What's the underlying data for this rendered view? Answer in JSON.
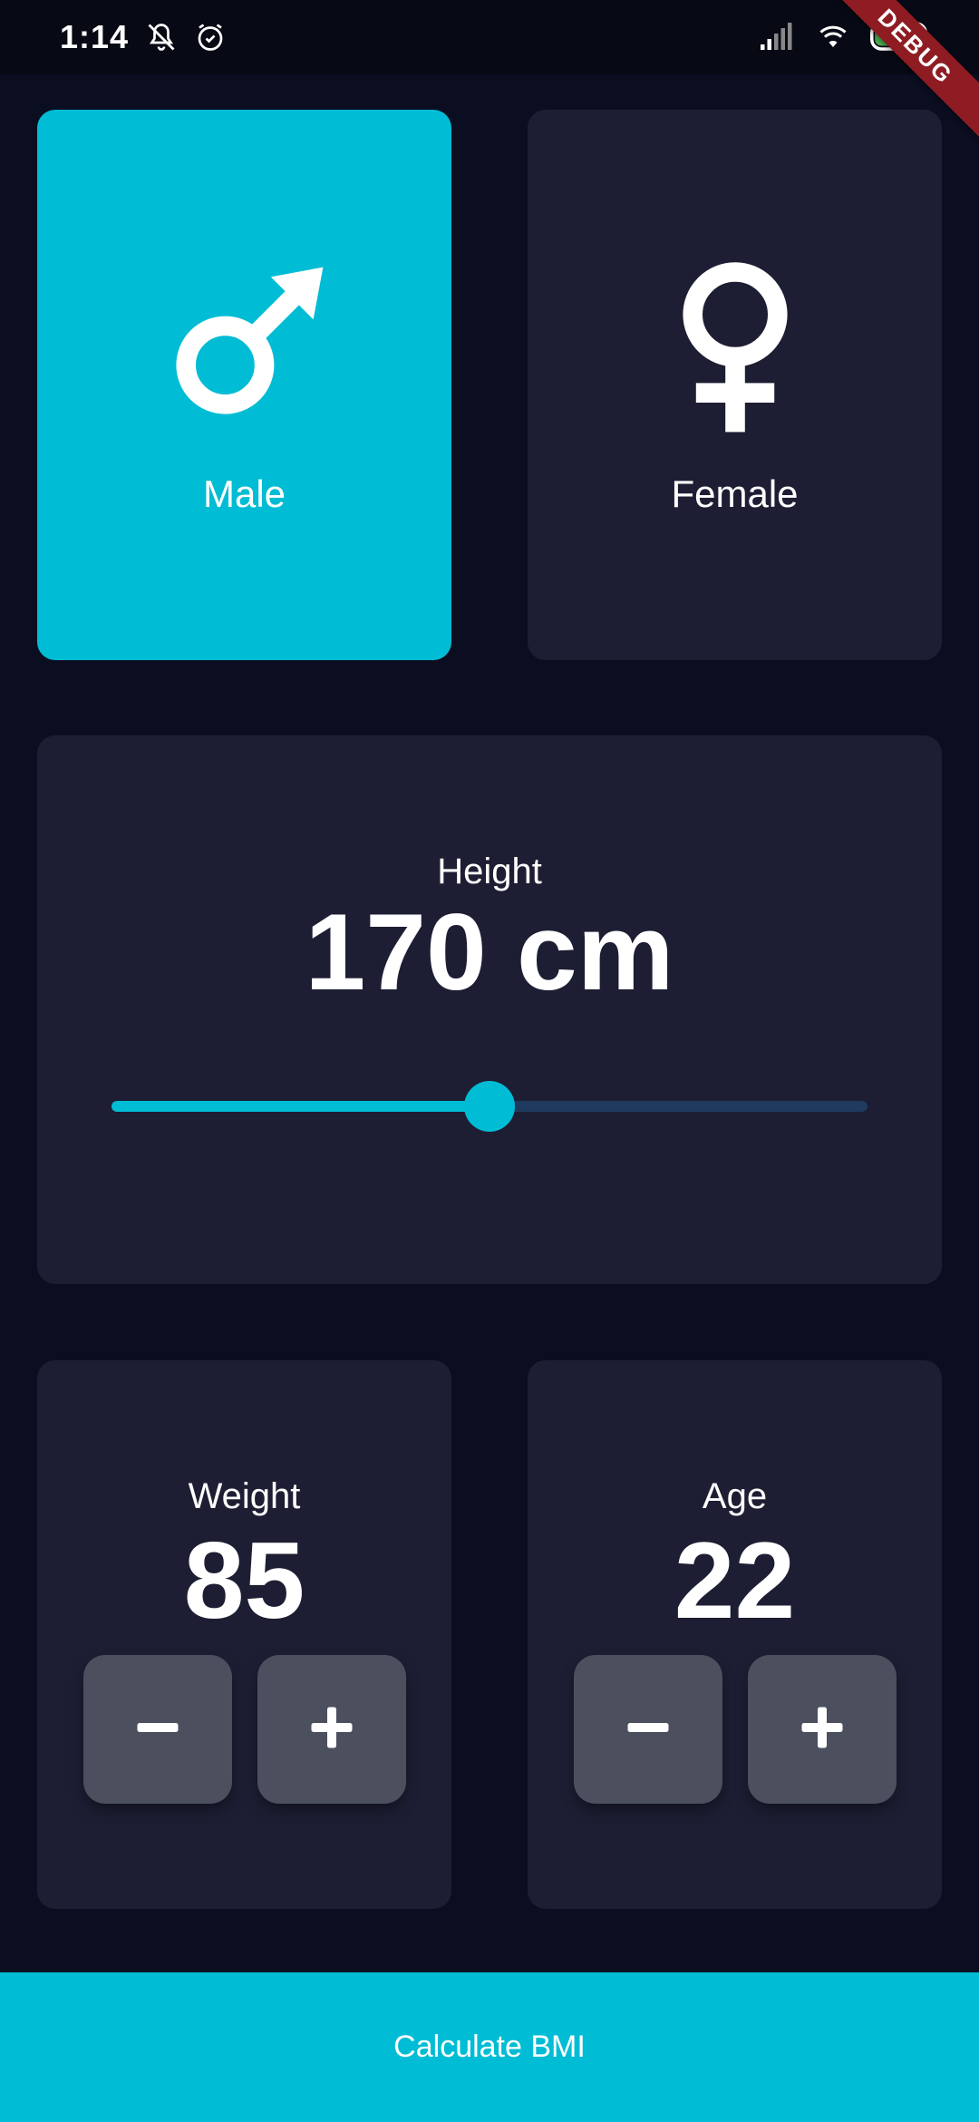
{
  "status_bar": {
    "time": "1:14",
    "icons": [
      "notifications-off-icon",
      "alarm-icon",
      "signal-icon",
      "wifi-icon",
      "battery-charging-icon"
    ],
    "debug_banner": "DEBUG"
  },
  "gender": {
    "male": {
      "label": "Male",
      "icon": "male-symbol-icon",
      "selected": true
    },
    "female": {
      "label": "Female",
      "icon": "female-symbol-icon",
      "selected": false
    }
  },
  "height": {
    "label": "Height",
    "value_text": "170 cm",
    "slider_fraction": 0.5
  },
  "weight": {
    "label": "Weight",
    "value": "85",
    "decrement_icon": "minus-icon",
    "increment_icon": "plus-icon"
  },
  "age": {
    "label": "Age",
    "value": "22",
    "decrement_icon": "minus-icon",
    "increment_icon": "plus-icon"
  },
  "calculate_button": {
    "label": "Calculate BMI"
  },
  "colors": {
    "background": "#0b0e21",
    "card": "#1d1e33",
    "accent": "#00bcd4",
    "button": "#4c4f5e",
    "slider_inactive": "#1f3a5e"
  }
}
